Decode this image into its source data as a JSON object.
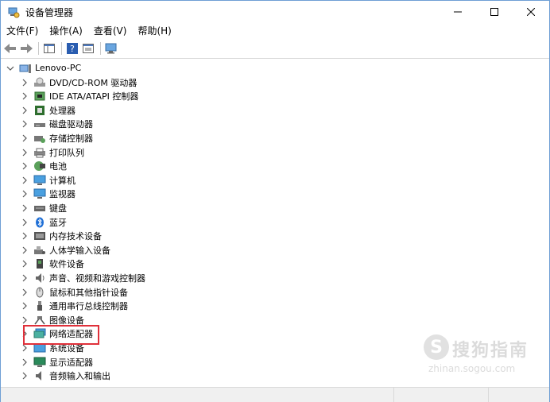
{
  "window": {
    "title": "设备管理器"
  },
  "menu": [
    "文件(F)",
    "操作(A)",
    "查看(V)",
    "帮助(H)"
  ],
  "root": {
    "label": "Lenovo-PC"
  },
  "categories": [
    {
      "label": "DVD/CD-ROM 驱动器",
      "icon": "dvd-drive-icon"
    },
    {
      "label": "IDE ATA/ATAPI 控制器",
      "icon": "ide-controller-icon"
    },
    {
      "label": "处理器",
      "icon": "processor-icon"
    },
    {
      "label": "磁盘驱动器",
      "icon": "disk-drive-icon"
    },
    {
      "label": "存储控制器",
      "icon": "storage-controller-icon"
    },
    {
      "label": "打印队列",
      "icon": "printer-icon"
    },
    {
      "label": "电池",
      "icon": "battery-icon"
    },
    {
      "label": "计算机",
      "icon": "computer-icon"
    },
    {
      "label": "监视器",
      "icon": "monitor-icon"
    },
    {
      "label": "键盘",
      "icon": "keyboard-icon"
    },
    {
      "label": "蓝牙",
      "icon": "bluetooth-icon"
    },
    {
      "label": "内存技术设备",
      "icon": "memory-icon"
    },
    {
      "label": "人体学输入设备",
      "icon": "hid-icon"
    },
    {
      "label": "软件设备",
      "icon": "software-device-icon"
    },
    {
      "label": "声音、视频和游戏控制器",
      "icon": "sound-icon"
    },
    {
      "label": "鼠标和其他指针设备",
      "icon": "mouse-icon"
    },
    {
      "label": "通用串行总线控制器",
      "icon": "usb-icon"
    },
    {
      "label": "图像设备",
      "icon": "camera-icon"
    },
    {
      "label": "网络适配器",
      "icon": "network-adapter-icon"
    },
    {
      "label": "系统设备",
      "icon": "system-device-icon"
    },
    {
      "label": "显示适配器",
      "icon": "display-adapter-icon"
    },
    {
      "label": "音频输入和输出",
      "icon": "audio-io-icon"
    }
  ],
  "highlighted_item": "网络适配器",
  "colors": {
    "highlight_border": "#e0303a",
    "window_border": "#6e9fd4"
  },
  "watermark": {
    "brand": "搜狗指南",
    "url": "zhinan.sogou.com"
  }
}
